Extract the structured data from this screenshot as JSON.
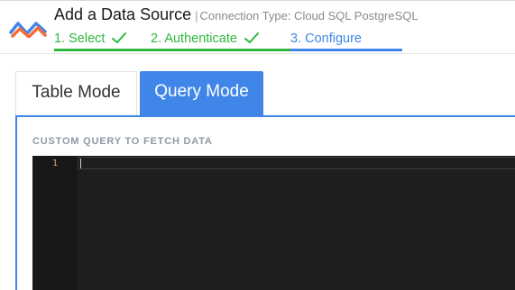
{
  "header": {
    "title": "Add a Data Source",
    "separator": "|",
    "connection_type": "Connection Type: Cloud SQL PostgreSQL",
    "steps": [
      {
        "label": "1. Select",
        "status": "done"
      },
      {
        "label": "2. Authenticate",
        "status": "done"
      },
      {
        "label": "3. Configure",
        "status": "active"
      }
    ]
  },
  "tabs": [
    {
      "label": "Table Mode",
      "selected": false
    },
    {
      "label": "Query Mode",
      "selected": true
    }
  ],
  "query_panel": {
    "label": "CUSTOM QUERY TO FETCH DATA",
    "editor": {
      "line_numbers": [
        "1"
      ],
      "content": ""
    }
  },
  "colors": {
    "accent_blue": "#3f86e8",
    "done_green": "#2db83d",
    "logo_blue": "#3f86e8",
    "logo_orange": "#f26b3a",
    "editor_bg": "#1e1e1e"
  },
  "icons": {
    "logo": "brand-logo-icon",
    "check": "checkmark-icon"
  }
}
